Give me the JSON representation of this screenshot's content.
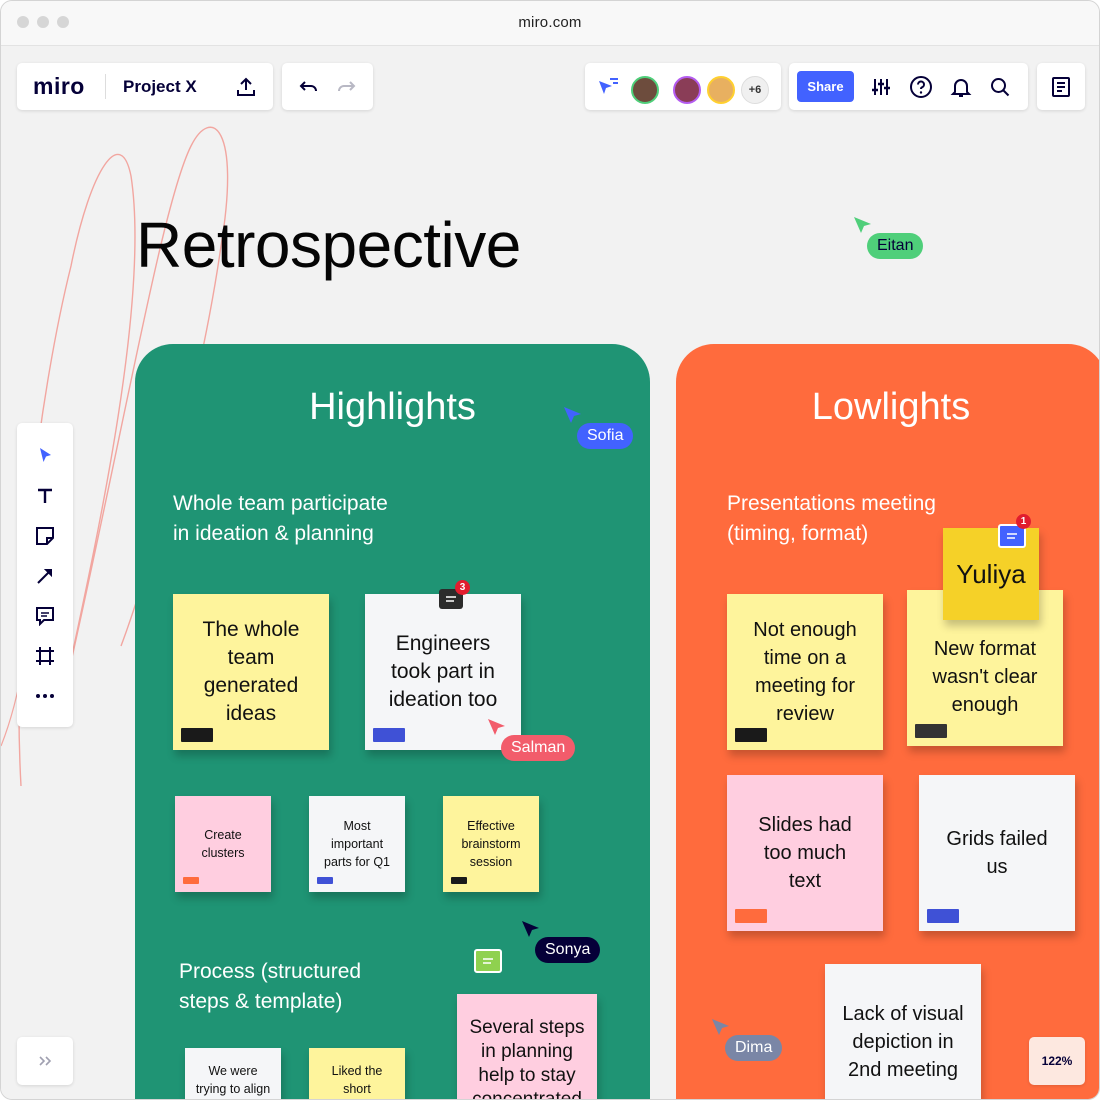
{
  "browser": {
    "url": "miro.com"
  },
  "toolbar": {
    "logo": "miro",
    "board_name": "Project X",
    "collaborators_more": "+6",
    "share_label": "Share"
  },
  "board": {
    "title": "Retrospective",
    "highlights": {
      "title": "Highlights",
      "section1": "Whole team participate\nin ideation & planning",
      "section2": "Process (structured\nsteps & template)",
      "stickies": [
        {
          "text": "The whole\nteam\ngenerated\nideas",
          "color": "#fef49c"
        },
        {
          "text": "Engineers\ntook part in\nideation too",
          "color": "#f5f6f8"
        },
        {
          "text": "Create\nclusters",
          "color": "#ffcee0"
        },
        {
          "text": "Most\nimportant\nparts for Q1",
          "color": "#f5f6f8"
        },
        {
          "text": "Effective\nbrainstorm\nsession",
          "color": "#fef49c"
        },
        {
          "text": "We were\ntrying to align",
          "color": "#f5f6f8"
        },
        {
          "text": "Liked the\nshort",
          "color": "#fef49c"
        },
        {
          "text": "Several steps\nin planning\nhelp to stay\nconcentrated",
          "color": "#ffcee0"
        }
      ],
      "comment_count": "3"
    },
    "lowlights": {
      "title": "Lowlights",
      "section1": "Presentations meeting\n(timing, format)",
      "stickies": [
        {
          "text": "Not enough\ntime on a\nmeeting for\nreview",
          "color": "#fef49c"
        },
        {
          "text": "New format\nwasn't clear\nenough",
          "color": "#fef49c"
        },
        {
          "text": "Yuliya",
          "color": "#f5d128"
        },
        {
          "text": "Slides had\ntoo much\ntext",
          "color": "#ffcee0"
        },
        {
          "text": "Grids failed\nus",
          "color": "#f5f6f8"
        },
        {
          "text": "Lack of visual\ndepiction in\n2nd meeting",
          "color": "#f5f6f8"
        }
      ],
      "comment_count": "1"
    }
  },
  "cursors": {
    "eitan": "Eitan",
    "sofia": "Sofia",
    "salman": "Salman",
    "sonya": "Sonya",
    "dima": "Dima"
  },
  "zoom": "122%",
  "colors": {
    "highlights_bg": "#1f9474",
    "lowlights_bg": "#ff6b3d",
    "accent": "#4262ff",
    "eitan": "#4fcf7a",
    "sofia": "#4262ff",
    "salman": "#f25c6b",
    "sonya": "#050038",
    "dima": "#7a86a6"
  },
  "icons": [
    "upload-icon",
    "undo-icon",
    "redo-icon",
    "cursor-tracking-icon",
    "settings-sliders-icon",
    "help-icon",
    "bell-icon",
    "search-icon",
    "notes-icon",
    "select-icon",
    "text-icon",
    "sticky-note-icon",
    "arrow-icon",
    "comment-icon",
    "frame-icon",
    "more-icon",
    "expand-icon"
  ]
}
